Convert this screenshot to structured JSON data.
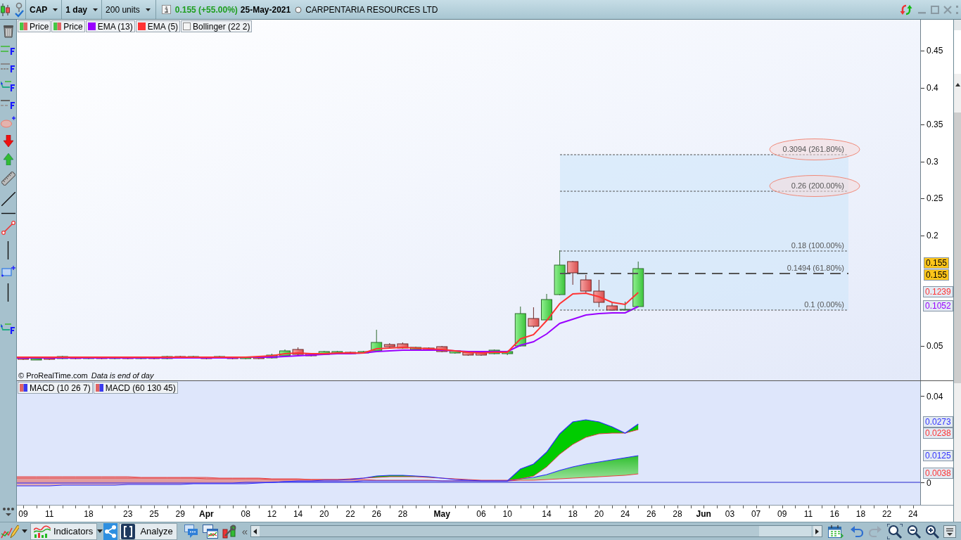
{
  "toolbar": {
    "symbol": "CAP",
    "period": "1 day",
    "units": "200 units",
    "change": "0.155 (+55.00%)",
    "date": "25-May-2021",
    "instrument": "CARPENTARIA RESOURCES LTD"
  },
  "legend": [
    {
      "label": "Price",
      "kind": "price"
    },
    {
      "label": "Price",
      "kind": "price"
    },
    {
      "label": "EMA (13)",
      "kind": "line",
      "color": "#9900ff"
    },
    {
      "label": "EMA (5)",
      "kind": "line",
      "color": "#ff3333"
    },
    {
      "label": "Bollinger (22 2)",
      "kind": "empty"
    }
  ],
  "fibonacci": [
    {
      "label": "0.3094 (261.80%)",
      "kind": "dotted",
      "circled": true
    },
    {
      "label": "0.26 (200.00%)",
      "kind": "dotted",
      "circled": true
    },
    {
      "label": "0.18 (100.00%)",
      "kind": "dotted",
      "circled": false
    },
    {
      "label": "0.1494 (61.80%)",
      "kind": "dashed",
      "circled": false
    },
    {
      "label": "0.1 (0.00%)",
      "kind": "dotted",
      "circled": false
    }
  ],
  "price_axis": {
    "ticks": [
      "0.45",
      "0.4",
      "0.35",
      "0.3",
      "0.25",
      "0.2",
      "0.05"
    ],
    "badges": [
      {
        "text": "0.155",
        "kind": "last"
      },
      {
        "text": "0.155",
        "kind": "last"
      },
      {
        "text": "0.1239",
        "kind": "line",
        "color": "#ff3333"
      },
      {
        "text": "0.1052",
        "kind": "line",
        "color": "#9900ff"
      }
    ]
  },
  "credit": {
    "site": "© ProRealTime.com",
    "note": "Data is end of day"
  },
  "macd_legend": [
    {
      "label": "MACD (10 26 7)"
    },
    {
      "label": "MACD (60 130 45)"
    }
  ],
  "macd_axis": {
    "ticks": [
      "0.04",
      "0"
    ],
    "badges": [
      {
        "text": "0.0273",
        "color": "#3333ff"
      },
      {
        "text": "0.0238",
        "color": "#ff3333"
      },
      {
        "text": "0.0125",
        "color": "#3333ff"
      },
      {
        "text": "0.0038",
        "color": "#ff3333"
      }
    ]
  },
  "dates": [
    {
      "label": "09",
      "kind": "day"
    },
    {
      "label": "11",
      "kind": "day"
    },
    {
      "label": "18",
      "kind": "day"
    },
    {
      "label": "23",
      "kind": "day"
    },
    {
      "label": "25",
      "kind": "day"
    },
    {
      "label": "29",
      "kind": "day"
    },
    {
      "label": "Apr",
      "kind": "month"
    },
    {
      "label": "08",
      "kind": "day"
    },
    {
      "label": "12",
      "kind": "day"
    },
    {
      "label": "14",
      "kind": "day"
    },
    {
      "label": "20",
      "kind": "day"
    },
    {
      "label": "22",
      "kind": "day"
    },
    {
      "label": "26",
      "kind": "day"
    },
    {
      "label": "28",
      "kind": "day"
    },
    {
      "label": "May",
      "kind": "month"
    },
    {
      "label": "06",
      "kind": "day"
    },
    {
      "label": "10",
      "kind": "day"
    },
    {
      "label": "14",
      "kind": "day"
    },
    {
      "label": "18",
      "kind": "day"
    },
    {
      "label": "20",
      "kind": "day"
    },
    {
      "label": "24",
      "kind": "day"
    },
    {
      "label": "26",
      "kind": "day"
    },
    {
      "label": "28",
      "kind": "day"
    },
    {
      "label": "Jun",
      "kind": "month"
    },
    {
      "label": "03",
      "kind": "day"
    },
    {
      "label": "07",
      "kind": "day"
    },
    {
      "label": "09",
      "kind": "day"
    },
    {
      "label": "11",
      "kind": "day"
    },
    {
      "label": "16",
      "kind": "day"
    },
    {
      "label": "18",
      "kind": "day"
    },
    {
      "label": "22",
      "kind": "day"
    },
    {
      "label": "24",
      "kind": "day"
    }
  ],
  "bottom_toolbar": {
    "indicators": "Indicators",
    "analyze": "Analyze",
    "collapse": "«"
  }
}
